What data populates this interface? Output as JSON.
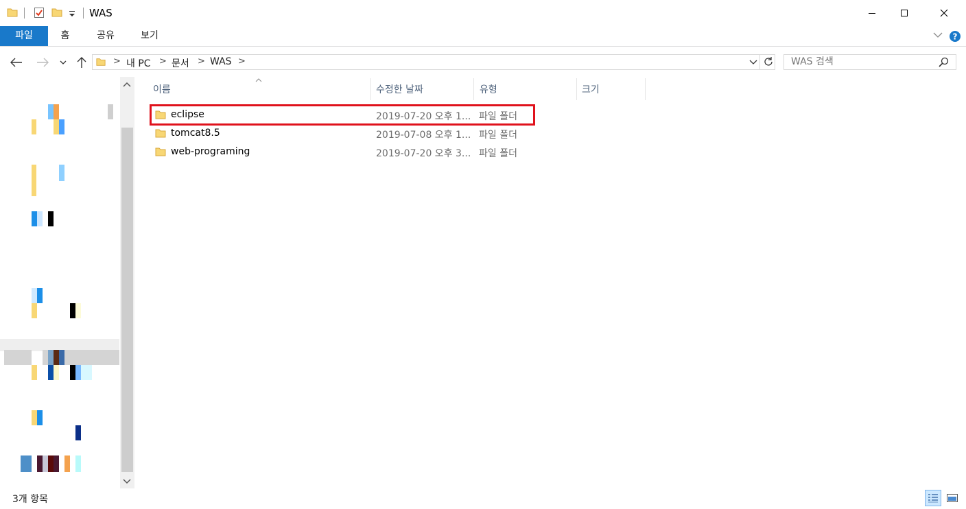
{
  "window": {
    "title": "WAS",
    "controls": [
      "minimize",
      "maximize",
      "close"
    ]
  },
  "quick_access": {
    "icons": [
      "folder-icon",
      "properties-icon",
      "new-folder-icon",
      "customize-dropdown-icon"
    ]
  },
  "ribbon": {
    "tabs": [
      {
        "label": "파일",
        "active": true
      },
      {
        "label": "홈"
      },
      {
        "label": "공유"
      },
      {
        "label": "보기"
      }
    ]
  },
  "address": {
    "path": [
      "내 PC",
      "문서",
      "WAS"
    ]
  },
  "search": {
    "placeholder": "WAS 검색"
  },
  "file_list": {
    "columns": [
      "이름",
      "수정한 날짜",
      "유형",
      "크기"
    ],
    "sorted_by": "이름",
    "rows": [
      {
        "name": "eclipse",
        "modified": "2019-07-20 오후 1...",
        "type": "파일 폴더",
        "highlighted": true
      },
      {
        "name": "tomcat8.5",
        "modified": "2019-07-08 오후 1...",
        "type": "파일 폴더"
      },
      {
        "name": "web-programing",
        "modified": "2019-07-20 오후 3...",
        "type": "파일 폴더"
      }
    ]
  },
  "status": {
    "item_count": "3개 항목"
  },
  "colors": {
    "accent": "#1979ca",
    "highlight_box": "#e0121c",
    "folder": "#f8d775"
  }
}
